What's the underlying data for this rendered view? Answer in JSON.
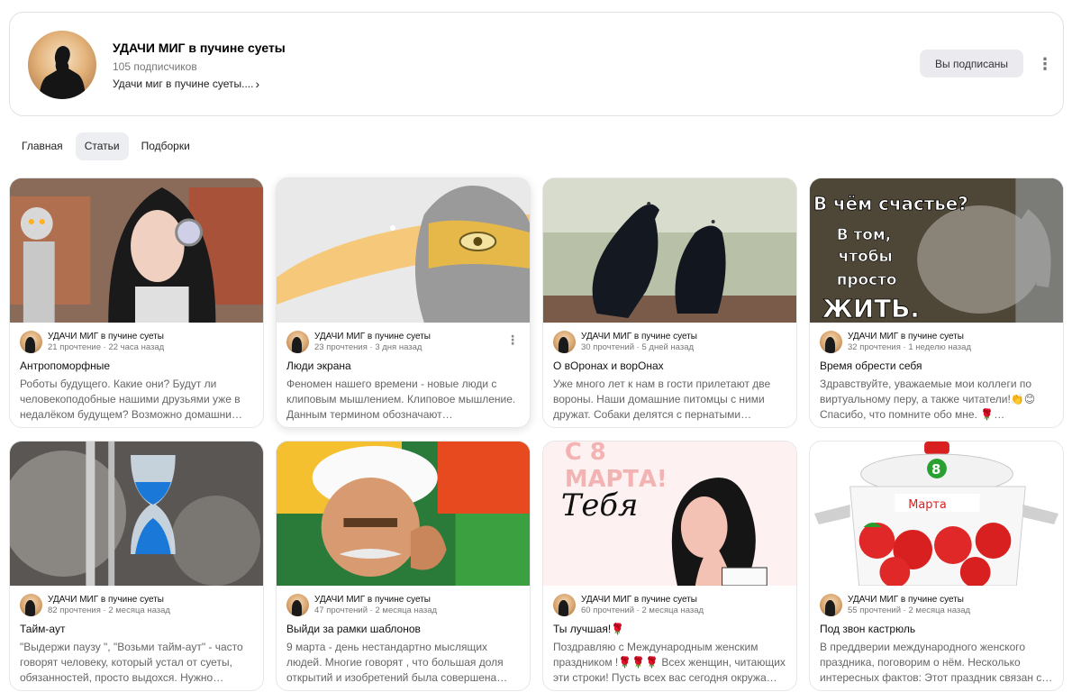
{
  "channel": {
    "title": "УДАЧИ МИГ в пучине суеты",
    "subscribers": "105 подписчиков",
    "description": "Удачи миг в пучине суеты....",
    "subscribed_label": "Вы подписаны"
  },
  "tabs": [
    {
      "label": "Главная",
      "active": false
    },
    {
      "label": "Статьи",
      "active": true
    },
    {
      "label": "Подборки",
      "active": false
    }
  ],
  "cards": [
    {
      "author": "УДАЧИ МИГ в пучине суеты",
      "stats": "21 прочтение · 22 часа назад",
      "title": "Антропоморфные",
      "snippet": "Роботы будущего. Какие они? Будут ли человекоподобные нашими друзьями уже в недалёком будущем? Возможно домашни…",
      "cover_icon": "robot-girl-image"
    },
    {
      "author": "УДАЧИ МИГ в пучине суеты",
      "stats": "23 прочтения · 3 дня назад",
      "title": "Люди экрана",
      "snippet": "Феномен нашего времени - новые люди с клиповым мышлением. Клиповое мышление. Данным термином обозначают…",
      "cover_icon": "statue-image"
    },
    {
      "author": "УДАЧИ МИГ в пучине суеты",
      "stats": "30 прочтений · 5 дней назад",
      "title": "О вОронах и ворОнах",
      "snippet": "Уже много лет к нам в гости прилетают две вороны. Наши домашние питомцы с ними дружат. Собаки делятся с пернатыми…",
      "cover_icon": "crows-image"
    },
    {
      "author": "УДАЧИ МИГ в пучине суеты",
      "stats": "32 прочтения · 1 неделю назад",
      "title": "Время обрести себя",
      "snippet": "Здравствуйте, уважаемые мои коллеги по виртуальному перу, а также читатели!👏😊 Спасибо, что помните обо мне. 🌹…",
      "cover_icon": "elephant-image"
    },
    {
      "author": "УДАЧИ МИГ в пучине суеты",
      "stats": "82 прочтения · 2 месяца назад",
      "title": "Тайм-аут",
      "snippet": "\"Выдержи паузу \", \"Возьми тайм-аут\" - часто говорят человеку, который устал от суеты, обязанностей, просто выдохся. Нужно…",
      "cover_icon": "hourglass-image"
    },
    {
      "author": "УДАЧИ МИГ в пучине суеты",
      "stats": "47 прочтений · 2 месяца назад",
      "title": "Выйди за рамки шаблонов",
      "snippet": "9 марта - день нестандартно мыслящих людей. Многие говорят , что большая доля открытий и изобретений была совершена…",
      "cover_icon": "einstein-image"
    },
    {
      "author": "УДАЧИ МИГ в пучине суеты",
      "stats": "60 прочтений · 2 месяца назад",
      "title": "Ты лучшая!🌹",
      "snippet": "Поздравляю с Международным женским праздником !🌹🌹🌹 Всех женщин, читающих эти строки! Пусть всех вас сегодня окружа…",
      "cover_icon": "woman-illustration-image"
    },
    {
      "author": "УДАЧИ МИГ в пучине суеты",
      "stats": "55 прочтений · 2 месяца назад",
      "title": "Под звон кастрюль",
      "snippet": "В преддверии международного женского праздника, поговорим о нём. Несколько интересных фактов: Этот праздник связан с…",
      "cover_icon": "pot-image"
    }
  ],
  "cover_texts": {
    "elephant_line1": "В чём счастье?",
    "elephant_line2": "В том,",
    "elephant_line3": "чтобы",
    "elephant_line4": "просто",
    "elephant_line5": "ЖИТЬ.",
    "march_line1": "С 8",
    "march_line2": "МАРТА!",
    "march_script": "Тебя",
    "pot_number": "8",
    "pot_label": "Марта"
  }
}
